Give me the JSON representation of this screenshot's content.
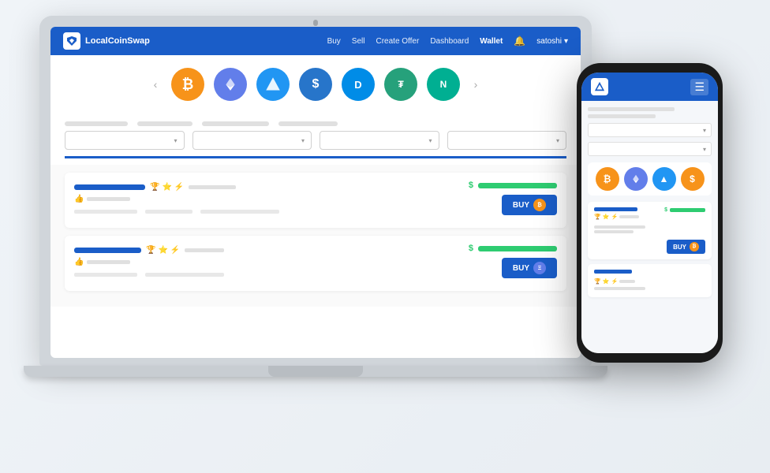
{
  "app": {
    "name": "LocalCoinSwap",
    "nav": {
      "buy": "Buy",
      "sell": "Sell",
      "create_offer": "Create Offer",
      "dashboard": "Dashboard",
      "wallet": "Wallet",
      "user": "satoshi"
    }
  },
  "crypto": {
    "btc_symbol": "₿",
    "eth_symbol": "Ξ",
    "lcs_symbol": "▲",
    "usdc_symbol": "$",
    "dash_symbol": "D",
    "usdt_symbol": "T",
    "neo_symbol": "N"
  },
  "listings": [
    {
      "buy_label": "BUY",
      "coin_type": "BTC"
    },
    {
      "buy_label": "BUY",
      "coin_type": "ETH"
    }
  ],
  "mobile": {
    "buy_label": "BUY",
    "coin_type": "BTC"
  },
  "badges": {
    "trophy": "🏆",
    "star": "⭐",
    "lightning": "⚡"
  }
}
